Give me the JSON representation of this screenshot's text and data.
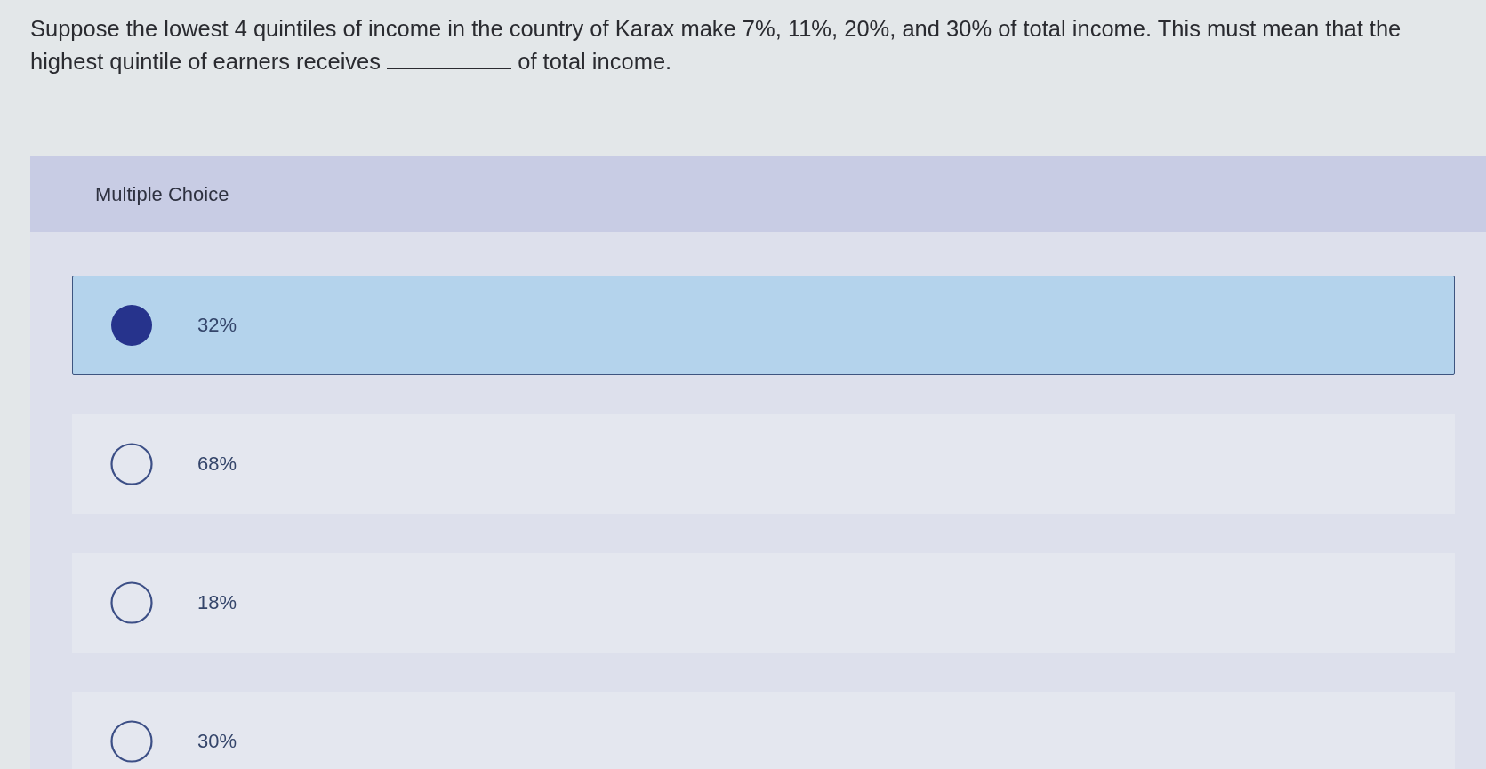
{
  "question": {
    "text_before_blank": "Suppose the lowest 4 quintiles of income in the country of Karax make 7%, 11%, 20%, and 30% of total income. This must mean that the highest quintile of earners receives",
    "text_after_blank": "of total income."
  },
  "answer_panel": {
    "heading": "Multiple Choice",
    "choices": [
      {
        "label": "32%",
        "selected": true
      },
      {
        "label": "68%",
        "selected": false
      },
      {
        "label": "18%",
        "selected": false
      },
      {
        "label": "30%",
        "selected": false
      }
    ]
  }
}
